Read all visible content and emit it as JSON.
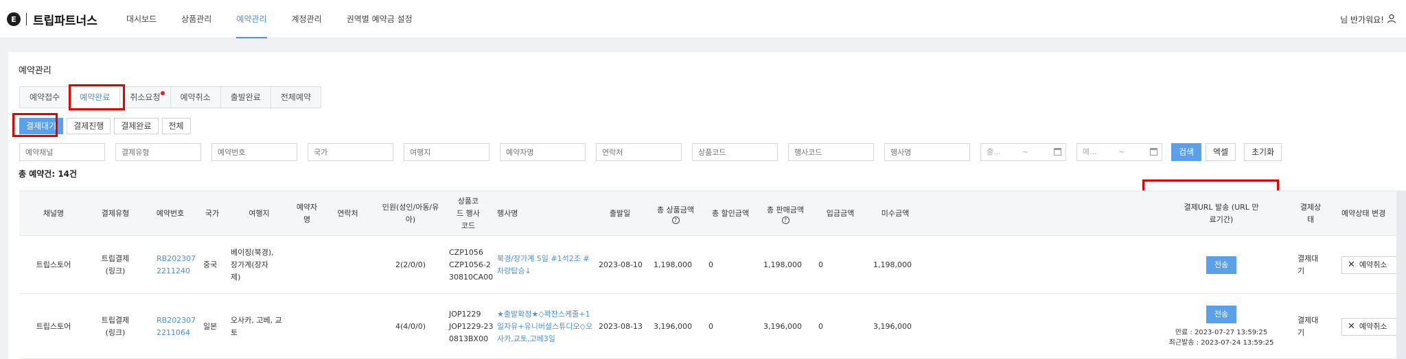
{
  "header": {
    "logo_badge": "E",
    "logo_text": "트립파트너스",
    "nav": [
      "대시보드",
      "상품관리",
      "예약관리",
      "계정관리",
      "권역별 예약금 설정"
    ],
    "active_nav": "예약관리",
    "greeting": "님 반가워요!",
    "user_icon": "user-icon"
  },
  "page": {
    "title": "예약관리",
    "tabs": [
      "예약접수",
      "예약완료",
      "취소요청",
      "예약취소",
      "출발완료",
      "전체예약"
    ],
    "active_tab": "예약완료",
    "sub_tabs": [
      "결제대기",
      "결제진행",
      "결제완료",
      "전체"
    ],
    "active_sub_tab": "결제대기",
    "filters": {
      "placeholders": [
        "예약채널",
        "결제유형",
        "예약번호",
        "국가",
        "여행지",
        "예약자명",
        "연락처",
        "상품코드",
        "행사코드",
        "행사명"
      ],
      "date_from_placeholder": "출...",
      "date_to_placeholder": "예...",
      "date_range_sep": "~",
      "buttons": [
        "검색",
        "엑셀",
        "초기화"
      ]
    },
    "total_label": "총 예약건: 14건"
  },
  "table": {
    "columns": [
      "채널명",
      "결제유형",
      "예약번호",
      "국가",
      "여행지",
      "예약자명",
      "연락처",
      "인원(성인/아동/유아)",
      "상품코드 행사코드",
      "행사명",
      "출발일",
      "총 상품금액",
      "총 할인금액",
      "총 판매금액",
      "입금금액",
      "미수금액",
      "결제URL 발송 (URL 만료기간)",
      "결제상태",
      "예약상태 변경"
    ],
    "rows": [
      {
        "channel": "트립스토어",
        "pay_type": "트립결제(링크)",
        "reservation_no": "RB2023072211240",
        "country": "중국",
        "destination": "베이징(북경), 장가계(장자제)",
        "booker": "",
        "contact": "",
        "people": "2(2/0/0)",
        "product_code": "CZP1056",
        "event_code": "CZP1056-230810CA00",
        "event_name": "북경/장가계 5일 #1석2조 #차량탑승↓",
        "departure": "2023-08-10",
        "total_product": "1,198,000",
        "total_discount": "0",
        "total_sale": "1,198,000",
        "deposit": "0",
        "unpaid": "1,198,000",
        "send_label": "전송",
        "expiry": "",
        "last_sent": "",
        "pay_status": "결제대기",
        "cancel_label": "예약취소"
      },
      {
        "channel": "트립스토어",
        "pay_type": "트립결제(링크)",
        "reservation_no": "RB2023072211064",
        "country": "일본",
        "destination": "오사카, 고베, 교토",
        "booker": "",
        "contact": "",
        "people": "4(4/0/0)",
        "product_code": "JOP1229",
        "event_code": "JOP1229-230813BX00",
        "event_name": "★출발확정★◇꽉찬스케줄+1일자유+유니버셜스튜디오◇오사카,교토,고베3일",
        "departure": "2023-08-13",
        "total_product": "3,196,000",
        "total_discount": "0",
        "total_sale": "3,196,000",
        "deposit": "0",
        "unpaid": "3,196,000",
        "send_label": "전송",
        "expiry": "만료 : 2023-07-27 13:59:25",
        "last_sent": "최근발송 : 2023-07-24 13:59:25",
        "pay_status": "결제대기",
        "cancel_label": "예약취소"
      }
    ]
  },
  "colors": {
    "accent": "#4a90d9",
    "primary_button": "#5aa0ea",
    "highlight_box": "#e00000",
    "notification_dot": "#e02020"
  }
}
